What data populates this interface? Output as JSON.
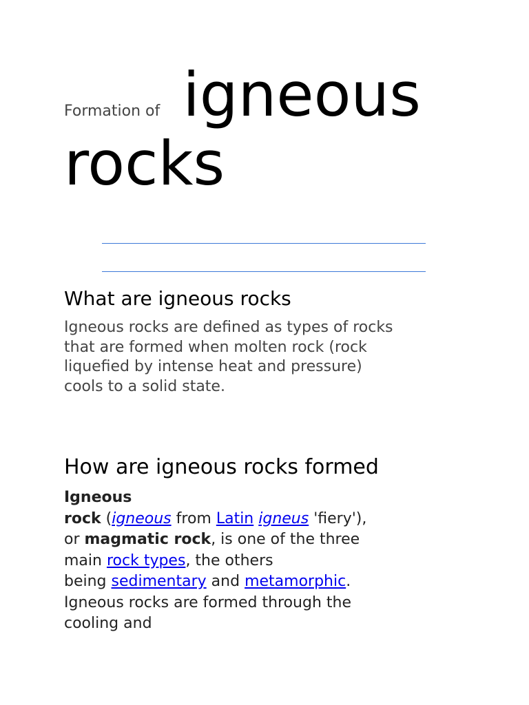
{
  "title": {
    "prefix": "Formation of",
    "word1": "igneous",
    "word2": "rocks"
  },
  "accent_color": "#3c78d8",
  "section1": {
    "heading": "What are igneous rocks",
    "lines": [
      "Igneous rocks are defined as types of rocks",
      "that are formed when molten rock (rock",
      "liquefied by intense heat and pressure)",
      "cools to a solid state."
    ]
  },
  "section2": {
    "heading": "How are igneous rocks formed",
    "t": {
      "b1": "Igneous",
      "b2": "rock",
      "s1": " (",
      "l1": "igneous",
      "s2": " from ",
      "l2": "Latin",
      "s3": " ",
      "l3": "igneus",
      "s4": " 'fiery'),",
      "s5": "or ",
      "b3": "magmatic rock",
      "s6": ", is one of the three",
      "s7": "main ",
      "l4": "rock types",
      "s8": ", the others",
      "s9": "being ",
      "l5": "sedimentary",
      "s10": " and ",
      "l6": "metamorphic",
      "s11": ".",
      "s12": "Igneous rocks are formed through the",
      "s13": "cooling and"
    }
  }
}
